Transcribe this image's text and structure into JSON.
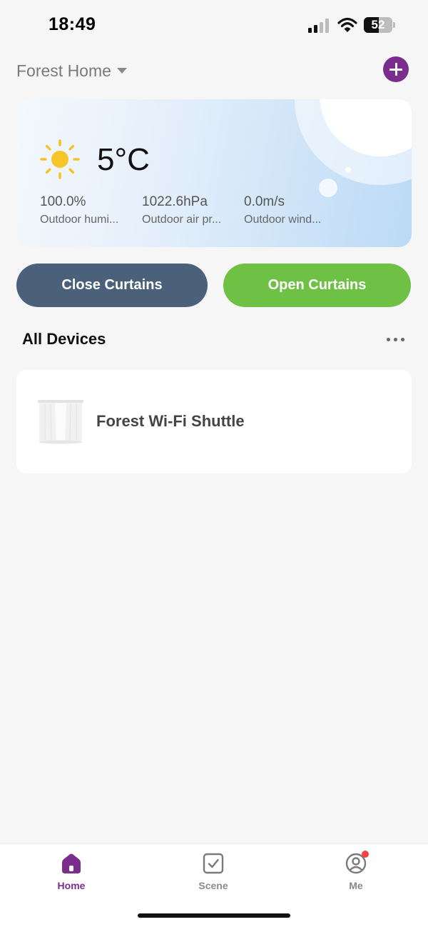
{
  "status_bar": {
    "time": "18:49",
    "battery_level": "52",
    "battery_fraction": 0.52
  },
  "header": {
    "home_name": "Forest Home"
  },
  "weather": {
    "temperature": "5°C",
    "metrics": [
      {
        "value": "100.0%",
        "label": "Outdoor humi..."
      },
      {
        "value": "1022.6hPa",
        "label": "Outdoor air pr..."
      },
      {
        "value": "0.0m/s",
        "label": "Outdoor wind..."
      }
    ]
  },
  "actions": {
    "close_label": "Close Curtains",
    "open_label": "Open Curtains"
  },
  "devices": {
    "section_title": "All Devices",
    "items": [
      {
        "name": "Forest Wi-Fi Shuttle"
      }
    ]
  },
  "tabs": [
    {
      "label": "Home",
      "active": true
    },
    {
      "label": "Scene",
      "active": false
    },
    {
      "label": "Me",
      "active": false,
      "has_notification": true
    }
  ],
  "colors": {
    "accent_purple": "#7b2d8e",
    "close_button": "#4a6179",
    "open_button": "#6fc146",
    "notification": "#f04444"
  },
  "icons": {
    "sun": "sun-icon",
    "add": "plus-icon",
    "more": "more-horizontal-icon",
    "home": "home-icon",
    "scene": "checkbox-icon",
    "me": "user-circle-icon"
  }
}
